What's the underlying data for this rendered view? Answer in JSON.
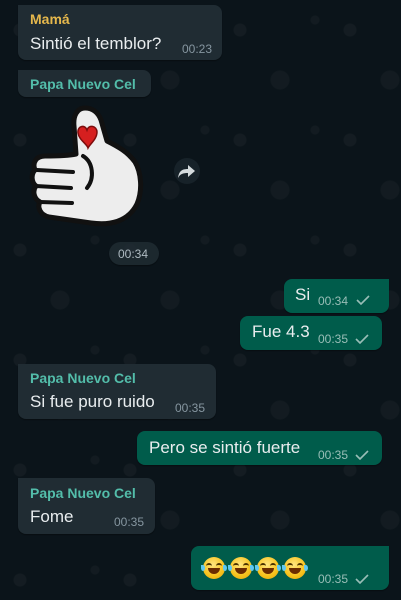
{
  "colors": {
    "chat_bg": "#0b141a",
    "incoming_bubble": "#202c33",
    "outgoing_bubble": "#005c4b",
    "sender_mama": "#e6b84c",
    "sender_papa": "#53bdaa",
    "text": "#e9edef",
    "time": "#8696a0",
    "read_ticks": "#99beb7"
  },
  "messages": [
    {
      "sender": "Mamá",
      "text": "Sintió el temblor?",
      "time": "00:23"
    },
    {
      "sender": "Papa Nuevo Cel",
      "sticker": "thumbs-up-heart-sticker",
      "time": "00:34"
    },
    {
      "text": "Si",
      "time": "00:34",
      "status": "sent"
    },
    {
      "text": "Fue 4.3",
      "time": "00:35",
      "status": "sent"
    },
    {
      "sender": "Papa Nuevo Cel",
      "text": "Si fue puro ruido",
      "time": "00:35"
    },
    {
      "text": "Pero se sintió fuerte",
      "time": "00:35",
      "status": "sent"
    },
    {
      "sender": "Papa Nuevo Cel",
      "text": "Fome",
      "time": "00:35"
    },
    {
      "emoji_count": 4,
      "emoji": "face-with-tears-of-joy",
      "time": "00:35",
      "status": "sent"
    }
  ]
}
